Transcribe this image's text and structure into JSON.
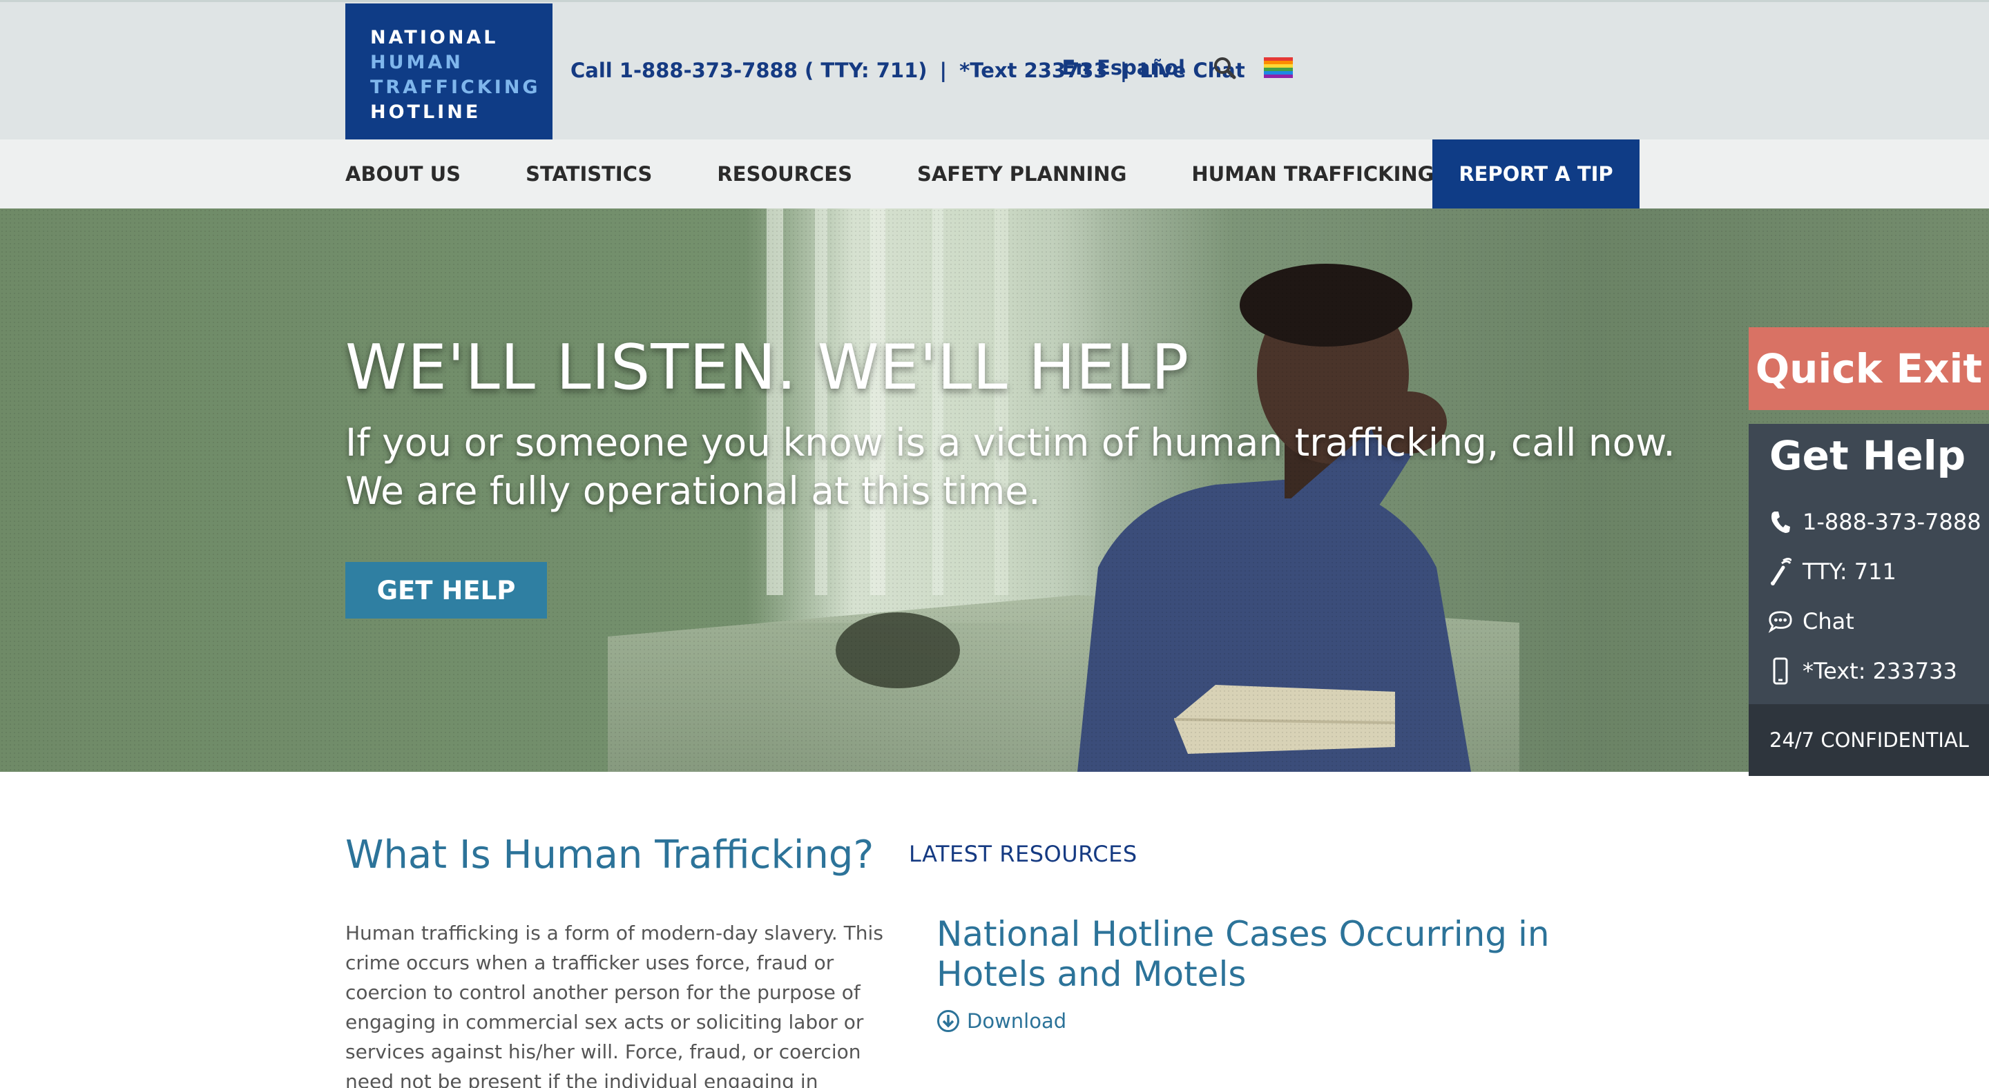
{
  "logo": {
    "line1": "NATIONAL",
    "line2": "HUMAN",
    "line3": "TRAFFICKING",
    "line4": "HOTLINE"
  },
  "topbar": {
    "call": "Call 1-888-373-7888 ( TTY: 711)",
    "text": "*Text 233733",
    "separator": "|",
    "chat": "Live Chat",
    "espanol": "En Español",
    "icons": [
      "search-icon",
      "pride-flag-icon"
    ]
  },
  "nav": {
    "items": [
      "ABOUT US",
      "STATISTICS",
      "RESOURCES",
      "SAFETY PLANNING",
      "HUMAN TRAFFICKING"
    ],
    "report": "REPORT A TIP"
  },
  "hero": {
    "title": "WE'LL LISTEN. WE'LL HELP",
    "subtitle_line1": "If you or someone you know is a victim of human trafficking, call now.",
    "subtitle_line2": "We are fully operational at this time.",
    "button": "GET HELP"
  },
  "widget": {
    "quick_exit": "Quick Exit",
    "title": "Get Help",
    "phone": "1-888-373-7888",
    "tty": "TTY: 711",
    "chat": "Chat",
    "text": "*Text: 233733",
    "footer": "24/7 CONFIDENTIAL",
    "icons": [
      "phone-icon",
      "tty-icon",
      "chat-icon",
      "mobile-icon"
    ]
  },
  "about": {
    "title": "What Is Human Trafficking?",
    "lines": [
      "Human trafficking is a form of modern-day slavery. This",
      "crime occurs when a trafficker uses force, fraud or",
      "coercion to control another person for the purpose of",
      "engaging in commercial sex acts or soliciting labor or",
      "services against his/her will. Force, fraud, or coercion",
      "need not be present if the individual engaging in"
    ]
  },
  "resources": {
    "heading": "LATEST RESOURCES",
    "item_title_line1": "National Hotline Cases Occurring in",
    "item_title_line2": "Hotels and Motels",
    "download": "Download"
  },
  "colors": {
    "brand_navy": "#0f3c86",
    "accent_teal": "#2c7399",
    "quick_exit": "#d97264",
    "widget_bg": "#3e4853"
  }
}
